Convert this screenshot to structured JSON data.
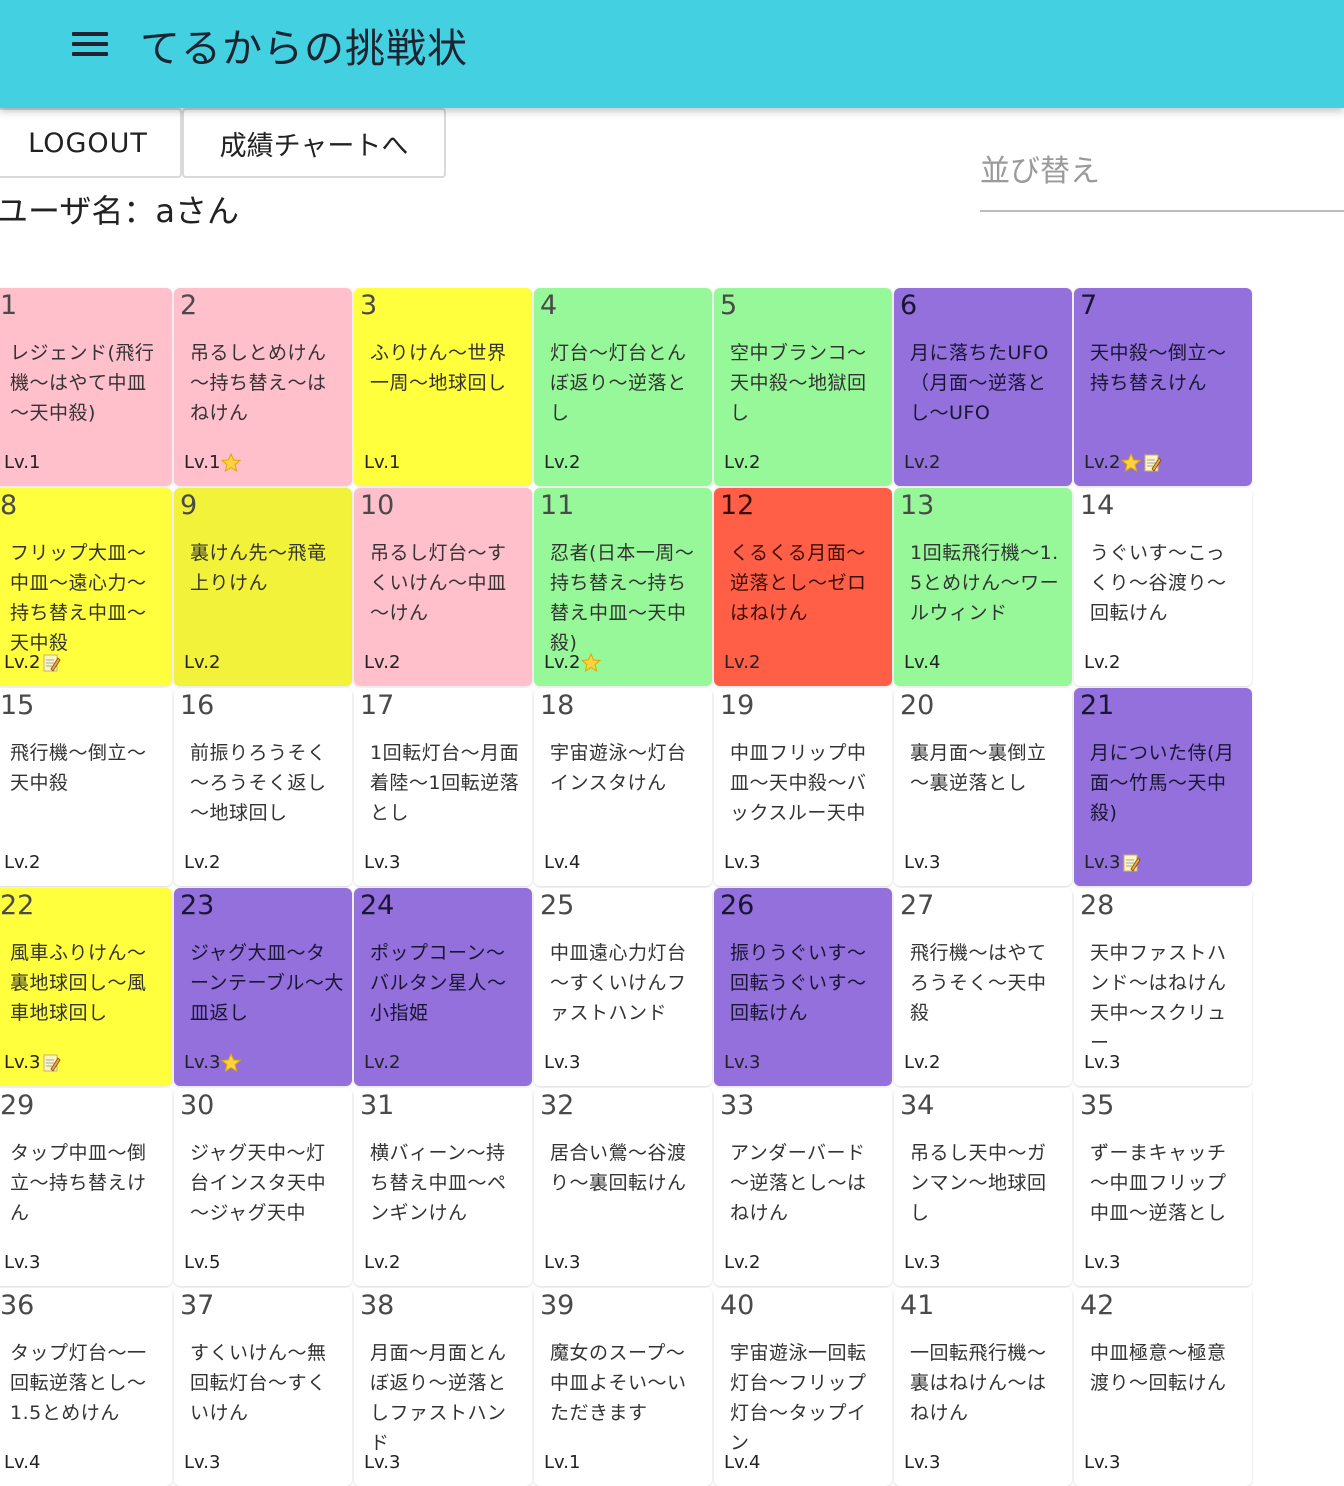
{
  "app": {
    "title": "てるからの挑戦状"
  },
  "buttons": {
    "logout": "LOGOUT",
    "chart": "成績チャートへ"
  },
  "user": {
    "label": "ユーザ名：aさん"
  },
  "sort": {
    "placeholder": "並び替え"
  },
  "colors": {
    "appbar": "#43D0E0",
    "pink": "#FFBFCB",
    "yellow": "#FFFF3D",
    "olive": "#F2F23A",
    "green": "#97F89A",
    "purple": "#9370DB",
    "red": "#FF5E47",
    "white": "#FFFFFF"
  },
  "cards": [
    {
      "num": "1",
      "title": "レジェンド(飛行機～はやて中皿～天中殺)",
      "level": "Lv.1",
      "color": "pink",
      "badges": []
    },
    {
      "num": "2",
      "title": "吊るしとめけん～持ち替え～はねけん",
      "level": "Lv.1",
      "color": "pink",
      "badges": [
        "star-icon"
      ]
    },
    {
      "num": "3",
      "title": "ふりけん～世界一周～地球回し",
      "level": "Lv.1",
      "color": "yellow",
      "badges": []
    },
    {
      "num": "4",
      "title": "灯台～灯台とんぼ返り～逆落とし",
      "level": "Lv.2",
      "color": "green",
      "badges": []
    },
    {
      "num": "5",
      "title": "空中ブランコ～天中殺～地獄回し",
      "level": "Lv.2",
      "color": "green",
      "badges": []
    },
    {
      "num": "6",
      "title": "月に落ちたUFO（月面～逆落とし～UFO",
      "level": "Lv.2",
      "color": "purple",
      "badges": []
    },
    {
      "num": "7",
      "title": "天中殺～倒立～持ち替えけん",
      "level": "Lv.2",
      "color": "purple",
      "badges": [
        "star-icon",
        "memo-icon"
      ]
    },
    {
      "num": "8",
      "title": "フリップ大皿～中皿～遠心力～持ち替え中皿～天中殺",
      "level": "Lv.2",
      "color": "yellow",
      "badges": [
        "memo-icon"
      ]
    },
    {
      "num": "9",
      "title": "裏けん先～飛竜上りけん",
      "level": "Lv.2",
      "color": "olive",
      "badges": []
    },
    {
      "num": "10",
      "title": "吊るし灯台～すくいけん～中皿～けん",
      "level": "Lv.2",
      "color": "pink",
      "badges": []
    },
    {
      "num": "11",
      "title": "忍者(日本一周～持ち替え～持ち替え中皿～天中殺)",
      "level": "Lv.2",
      "color": "green",
      "badges": [
        "star-icon"
      ]
    },
    {
      "num": "12",
      "title": "くるくる月面～逆落とし～ゼロはねけん",
      "level": "Lv.2",
      "color": "red",
      "badges": []
    },
    {
      "num": "13",
      "title": "1回転飛行機～1.5とめけん～ワールウィンド",
      "level": "Lv.4",
      "color": "green",
      "badges": []
    },
    {
      "num": "14",
      "title": "うぐいす～こっくり～谷渡り～回転けん",
      "level": "Lv.2",
      "color": "white",
      "badges": []
    },
    {
      "num": "15",
      "title": "飛行機～倒立～天中殺",
      "level": "Lv.2",
      "color": "white",
      "badges": []
    },
    {
      "num": "16",
      "title": "前振りろうそく～ろうそく返し～地球回し",
      "level": "Lv.2",
      "color": "white",
      "badges": []
    },
    {
      "num": "17",
      "title": "1回転灯台～月面着陸～1回転逆落とし",
      "level": "Lv.3",
      "color": "white",
      "badges": []
    },
    {
      "num": "18",
      "title": "宇宙遊泳～灯台インスタけん",
      "level": "Lv.4",
      "color": "white",
      "badges": []
    },
    {
      "num": "19",
      "title": "中皿フリップ中皿～天中殺～バックスルー天中",
      "level": "Lv.3",
      "color": "white",
      "badges": []
    },
    {
      "num": "20",
      "title": "裏月面～裏倒立～裏逆落とし",
      "level": "Lv.3",
      "color": "white",
      "badges": []
    },
    {
      "num": "21",
      "title": "月についた侍(月面～竹馬～天中殺)",
      "level": "Lv.3",
      "color": "purple",
      "badges": [
        "memo-icon"
      ]
    },
    {
      "num": "22",
      "title": "風車ふりけん～裏地球回し～風車地球回し",
      "level": "Lv.3",
      "color": "yellow",
      "badges": [
        "memo-icon"
      ]
    },
    {
      "num": "23",
      "title": "ジャグ大皿～ターンテーブル～大皿返し",
      "level": "Lv.3",
      "color": "purple",
      "badges": [
        "star-icon"
      ]
    },
    {
      "num": "24",
      "title": "ポップコーン～バルタン星人～小指姫",
      "level": "Lv.2",
      "color": "purple",
      "badges": []
    },
    {
      "num": "25",
      "title": "中皿遠心力灯台～すくいけんファストハンド",
      "level": "Lv.3",
      "color": "white",
      "badges": []
    },
    {
      "num": "26",
      "title": "振りうぐいす～回転うぐいす～回転けん",
      "level": "Lv.3",
      "color": "purple",
      "badges": []
    },
    {
      "num": "27",
      "title": "飛行機～はやてろうそく～天中殺",
      "level": "Lv.2",
      "color": "white",
      "badges": []
    },
    {
      "num": "28",
      "title": "天中ファストハンド～はねけん天中～スクリュー",
      "level": "Lv.3",
      "color": "white",
      "badges": []
    },
    {
      "num": "29",
      "title": "タップ中皿～倒立～持ち替えけん",
      "level": "Lv.3",
      "color": "white",
      "badges": []
    },
    {
      "num": "30",
      "title": "ジャグ天中～灯台インスタ天中～ジャグ天中",
      "level": "Lv.5",
      "color": "white",
      "badges": []
    },
    {
      "num": "31",
      "title": "横バィーン～持ち替え中皿～ペンギンけん",
      "level": "Lv.2",
      "color": "white",
      "badges": []
    },
    {
      "num": "32",
      "title": "居合い鶯～谷渡り～裏回転けん",
      "level": "Lv.3",
      "color": "white",
      "badges": []
    },
    {
      "num": "33",
      "title": "アンダーバード～逆落とし～はねけん",
      "level": "Lv.2",
      "color": "white",
      "badges": []
    },
    {
      "num": "34",
      "title": "吊るし天中～ガンマン～地球回し",
      "level": "Lv.3",
      "color": "white",
      "badges": []
    },
    {
      "num": "35",
      "title": "ずーまキャッチ～中皿フリップ中皿～逆落とし",
      "level": "Lv.3",
      "color": "white",
      "badges": []
    },
    {
      "num": "36",
      "title": "タップ灯台～一回転逆落とし～1.5とめけん",
      "level": "Lv.4",
      "color": "white",
      "badges": []
    },
    {
      "num": "37",
      "title": "すくいけん～無回転灯台～すくいけん",
      "level": "Lv.3",
      "color": "white",
      "badges": []
    },
    {
      "num": "38",
      "title": "月面～月面とんぼ返り～逆落としファストハンド",
      "level": "Lv.3",
      "color": "white",
      "badges": []
    },
    {
      "num": "39",
      "title": "魔女のスープ～中皿よそい～いただきます",
      "level": "Lv.1",
      "color": "white",
      "badges": []
    },
    {
      "num": "40",
      "title": "宇宙遊泳一回転灯台～フリップ灯台～タップイン",
      "level": "Lv.4",
      "color": "white",
      "badges": []
    },
    {
      "num": "41",
      "title": "一回転飛行機～裏はねけん～はねけん",
      "level": "Lv.3",
      "color": "white",
      "badges": []
    },
    {
      "num": "42",
      "title": "中皿極意～極意渡り～回転けん",
      "level": "Lv.3",
      "color": "white",
      "badges": []
    }
  ]
}
